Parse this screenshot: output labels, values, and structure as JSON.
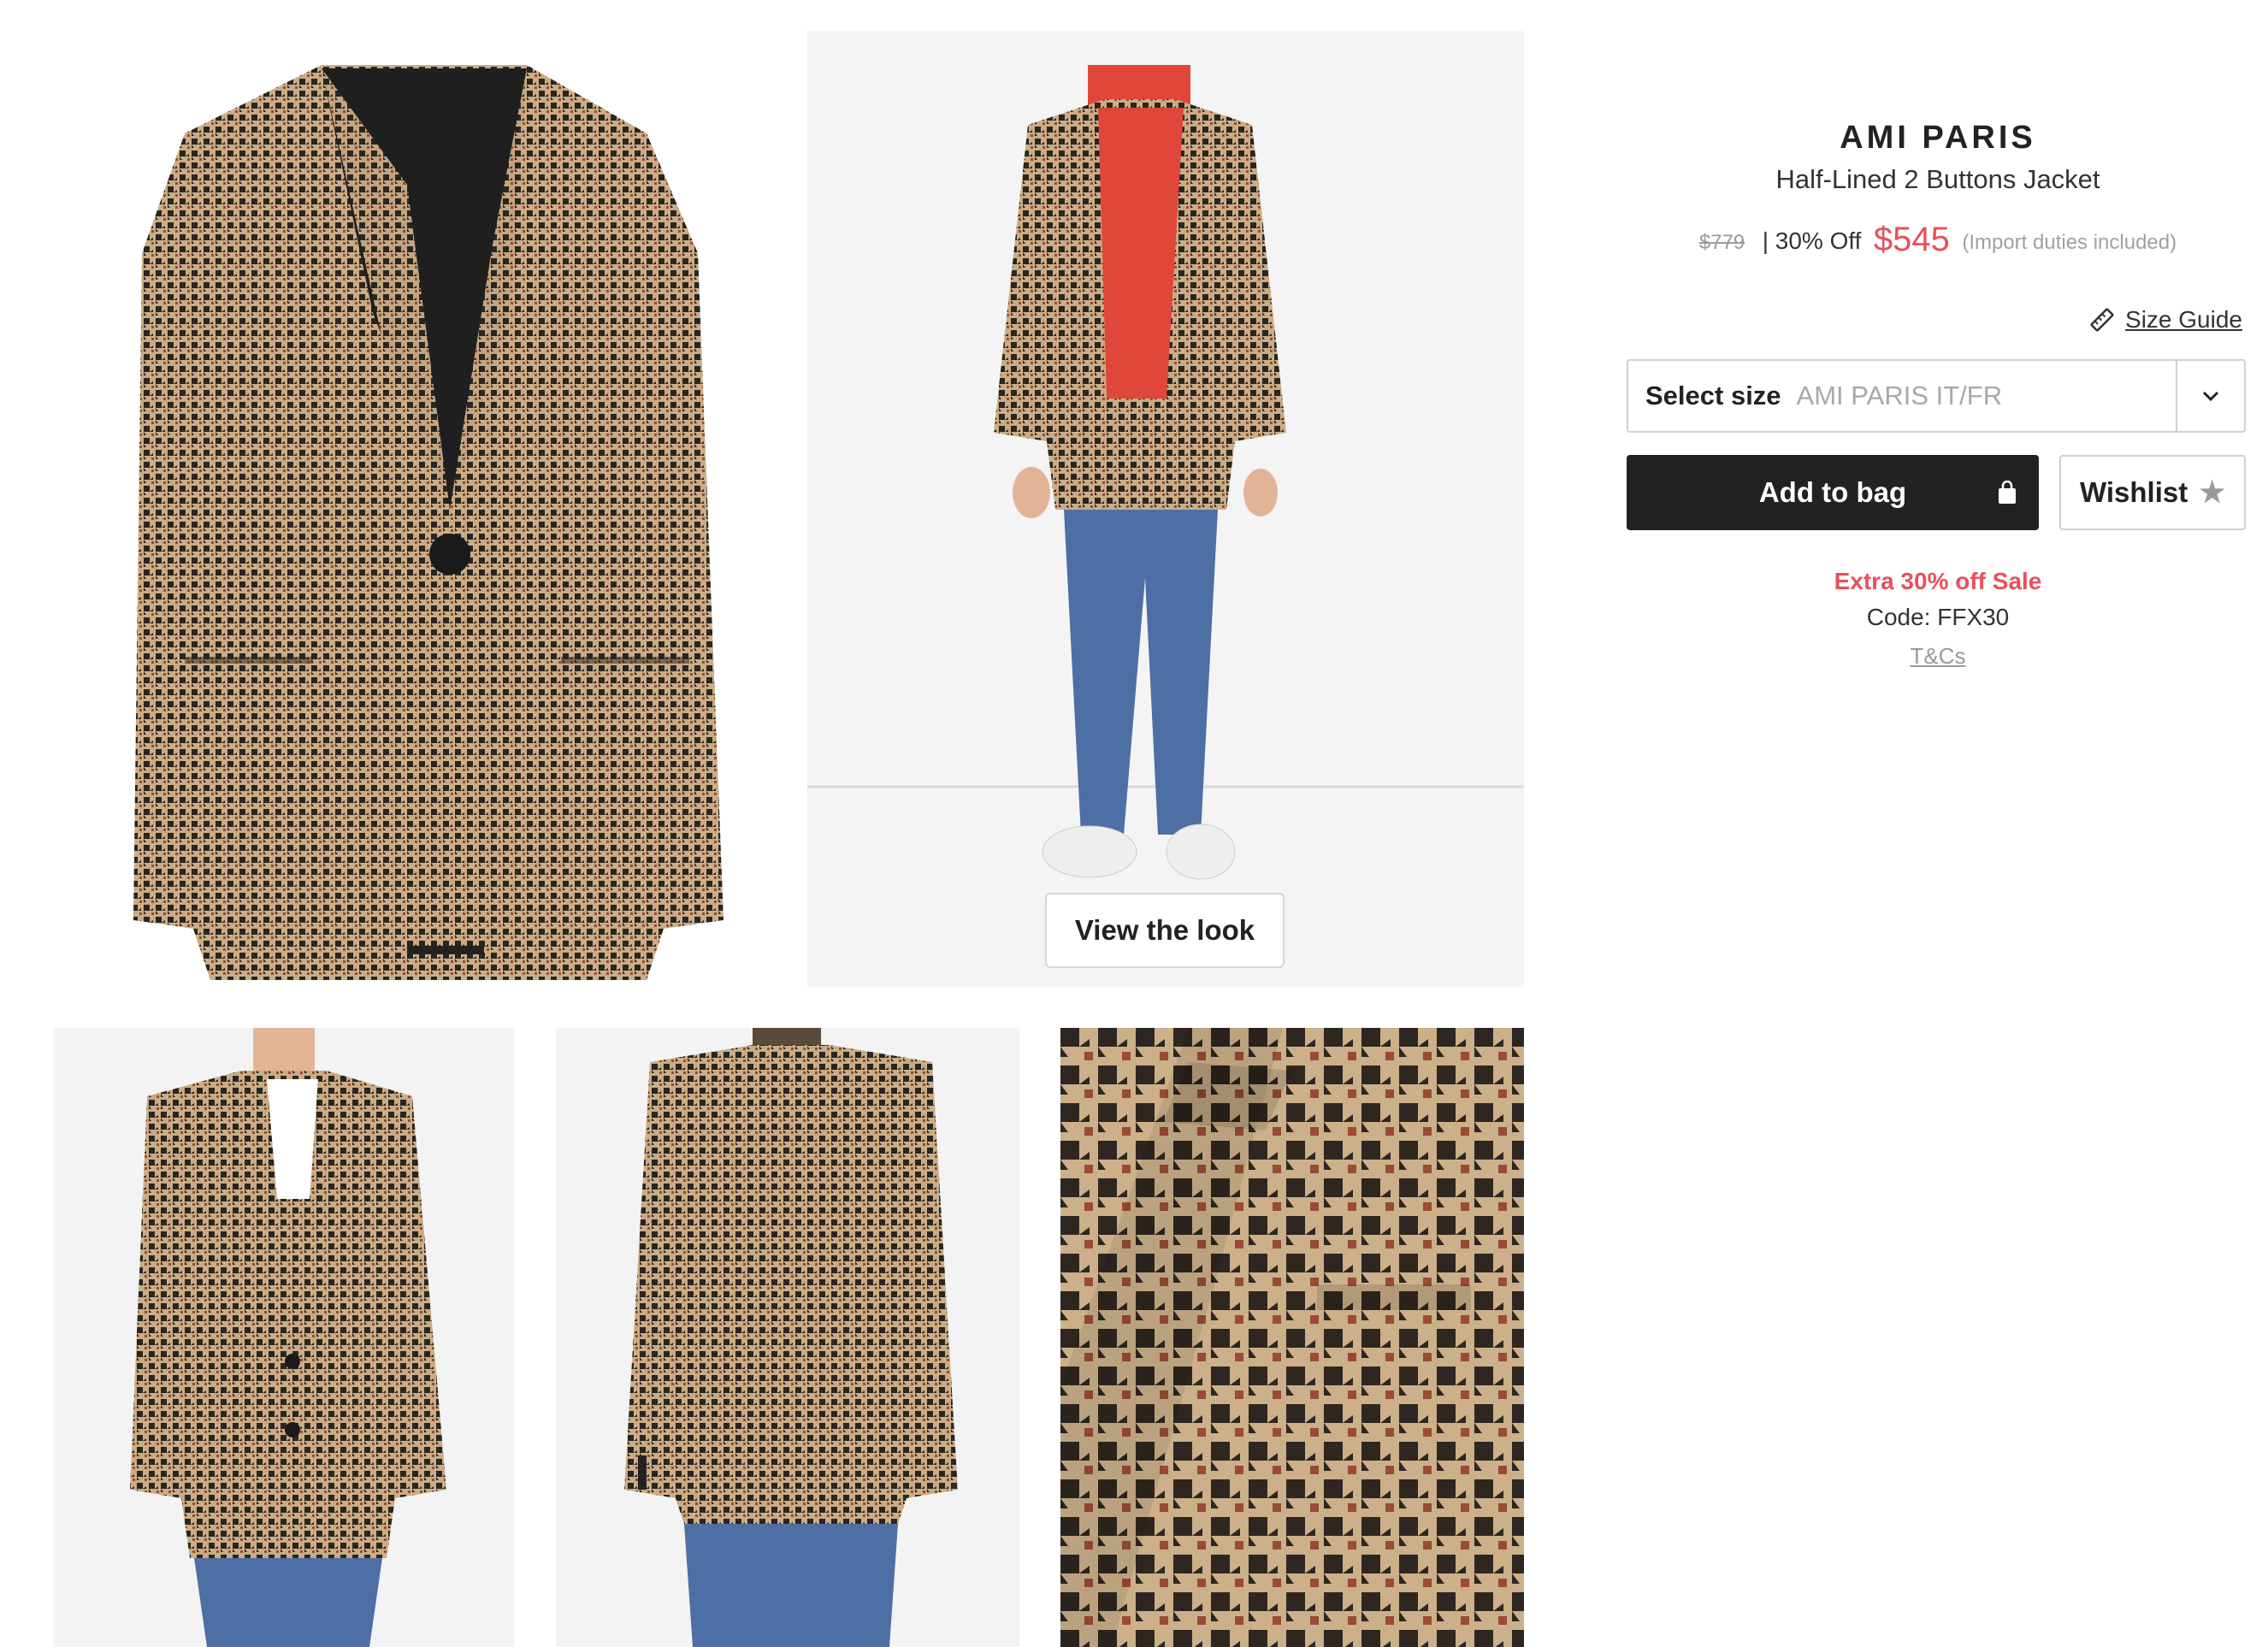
{
  "product": {
    "brand": "AMI PARIS",
    "name": "Half-Lined 2 Buttons Jacket",
    "price_original": "$779",
    "discount": "| 30% Off",
    "price_sale": "$545",
    "price_note": "(Import duties included)"
  },
  "size_guide_label": "Size Guide",
  "size_select": {
    "label": "Select size",
    "value": "AMI PARIS IT/FR"
  },
  "buttons": {
    "add_to_bag": "Add to bag",
    "wishlist": "Wishlist",
    "view_look": "View the look"
  },
  "promo": {
    "title": "Extra 30% off Sale",
    "code": "Code: FFX30",
    "terms": "T&Cs"
  },
  "colors": {
    "accent": "#e8505b",
    "button_dark": "#222222"
  },
  "icons": [
    "ruler-icon",
    "chevron-down-icon",
    "bag-icon",
    "star-icon"
  ]
}
